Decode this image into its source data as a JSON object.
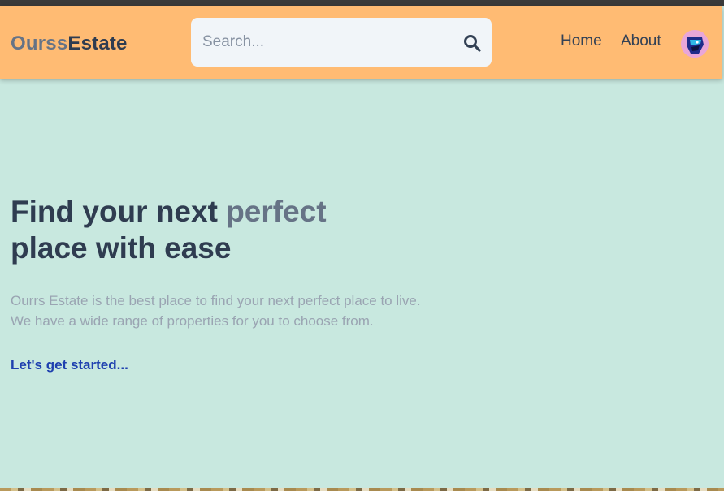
{
  "logo": {
    "part1": "Ourss",
    "part2": "Estate"
  },
  "search": {
    "placeholder": "Search...",
    "value": ""
  },
  "nav": {
    "home": "Home",
    "about": "About"
  },
  "hero": {
    "title_part1": "Find your next ",
    "title_accent": "perfect",
    "title_part2": "place with ease",
    "desc_line1": "Ourrs Estate is the best place to find your next perfect place to live.",
    "desc_line2": "We have a wide range of properties for you to choose from.",
    "cta": "Let's get started..."
  },
  "icons": {
    "search": "search-icon",
    "avatar": "user-avatar"
  },
  "colors": {
    "header_bg": "#ffbb73",
    "page_bg": "#c8e8df",
    "brand_muted": "#667386",
    "brand_dark": "#2f3c50",
    "link": "#1e40af"
  }
}
